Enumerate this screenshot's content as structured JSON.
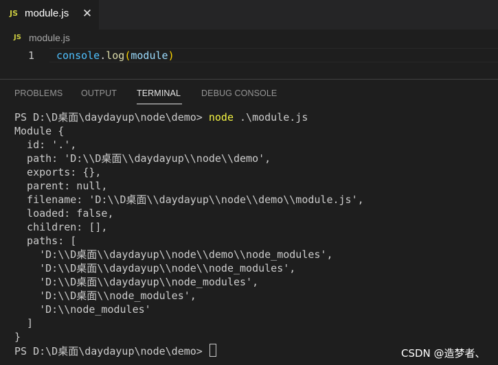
{
  "tabbar": {
    "tab": {
      "icon": "js-file-icon",
      "badge": "JS",
      "label": "module.js",
      "close_glyph": "✕"
    }
  },
  "breadcrumb": {
    "icon": "js-file-icon",
    "badge": "JS",
    "label": "module.js"
  },
  "editor": {
    "lines": [
      {
        "number": "1",
        "tokens": {
          "obj": "console",
          "dot": ".",
          "method": "log",
          "open": "(",
          "arg": "module",
          "close": ")"
        }
      }
    ]
  },
  "panel": {
    "tabs": [
      "PROBLEMS",
      "OUTPUT",
      "TERMINAL",
      "DEBUG CONSOLE"
    ],
    "active_tab": "TERMINAL"
  },
  "terminal": {
    "prompt": "PS D:\\D桌面\\daydayup\\node\\demo> ",
    "command": "node",
    "command_args": " .\\module.js",
    "output": [
      "Module {",
      "  id: '.',",
      "  path: 'D:\\\\D桌面\\\\daydayup\\\\node\\\\demo',",
      "  exports: {},",
      "  parent: null,",
      "  filename: 'D:\\\\D桌面\\\\daydayup\\\\node\\\\demo\\\\module.js',",
      "  loaded: false,",
      "  children: [],",
      "  paths: [",
      "    'D:\\\\D桌面\\\\daydayup\\\\node\\\\demo\\\\node_modules',",
      "    'D:\\\\D桌面\\\\daydayup\\\\node\\\\node_modules',",
      "    'D:\\\\D桌面\\\\daydayup\\\\node_modules',",
      "    'D:\\\\D桌面\\\\node_modules',",
      "    'D:\\\\node_modules'",
      "  ]",
      "}"
    ],
    "final_prompt": "PS D:\\D桌面\\daydayup\\node\\demo> "
  },
  "watermark": "CSDN @造梦者、",
  "colors": {
    "editor_bg": "#1e1e1e",
    "tabbar_bg": "#252526",
    "js_badge": "#cbcb41",
    "command": "#f5f543",
    "variable": "#4fc1ff",
    "function": "#dcdcaa",
    "bracket": "#ffd700",
    "parameter": "#9cdcfe"
  }
}
